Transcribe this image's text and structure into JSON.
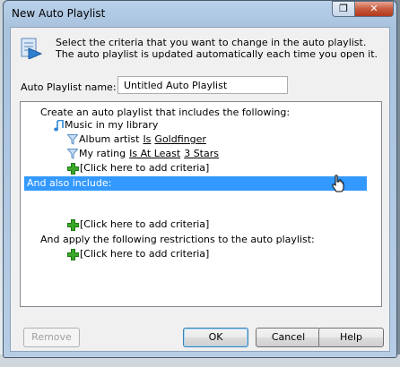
{
  "window": {
    "title": "New Auto Playlist",
    "close_glyph": "✕",
    "restore_glyph": "❐"
  },
  "header": {
    "line1": "Select the criteria that you want to change in the auto playlist.",
    "line2": "The auto playlist is updated automatically each time you open it.",
    "icon": "playlist-icon"
  },
  "name_field": {
    "label": "Auto Playlist name:",
    "value": "Untitled Auto Playlist"
  },
  "criteria": {
    "intro": "Create an auto playlist that includes the following:",
    "library": "Music in my library",
    "rule1": {
      "field": "Album artist",
      "operator": "Is",
      "value": "Goldfinger"
    },
    "rule2": {
      "field": "My rating",
      "operator": "Is At Least",
      "value": "3 Stars"
    },
    "add1": "[Click here to add criteria]",
    "also_include": "And also include:",
    "add2": "[Click here to add criteria]",
    "restrictions": "And apply the following restrictions to the auto playlist:",
    "add3": "[Click here to add criteria]"
  },
  "buttons": {
    "remove": "Remove",
    "ok": "OK",
    "cancel": "Cancel",
    "help": "Help"
  },
  "colors": {
    "selection": "#3399ff",
    "add_icon": "#3aa829",
    "filter_icon": "#5a8fc8",
    "note_icon": "#2f86d6"
  }
}
